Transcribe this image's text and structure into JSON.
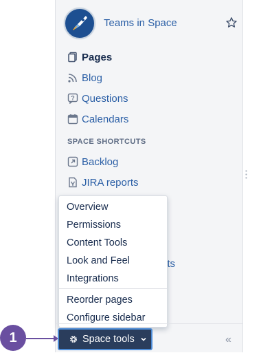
{
  "space": {
    "title": "Teams in Space",
    "logo_icon": "rocket-icon",
    "star_icon": "star-icon"
  },
  "nav": [
    {
      "label": "Pages",
      "icon": "pages-icon",
      "active": true
    },
    {
      "label": "Blog",
      "icon": "rss-icon",
      "active": false
    },
    {
      "label": "Questions",
      "icon": "question-icon",
      "active": false
    },
    {
      "label": "Calendars",
      "icon": "calendar-icon",
      "active": false
    }
  ],
  "shortcuts": {
    "title": "SPACE SHORTCUTS",
    "items": [
      {
        "label": "Backlog",
        "icon": "link-icon"
      },
      {
        "label": "JIRA reports",
        "icon": "report-icon"
      }
    ],
    "partially_hidden_text": "nts"
  },
  "space_tools_menu": {
    "group1": [
      "Overview",
      "Permissions",
      "Content Tools",
      "Look and Feel",
      "Integrations"
    ],
    "group2": [
      "Reorder pages",
      "Configure sidebar"
    ]
  },
  "footer": {
    "space_tools_label": "Space tools",
    "collapse_glyph": "«"
  },
  "callout": {
    "number": "1",
    "color": "#6a4fa0"
  },
  "colors": {
    "link": "#2b5fa6",
    "button_bg": "#2a3d5c",
    "button_border": "#4c8bd6"
  }
}
